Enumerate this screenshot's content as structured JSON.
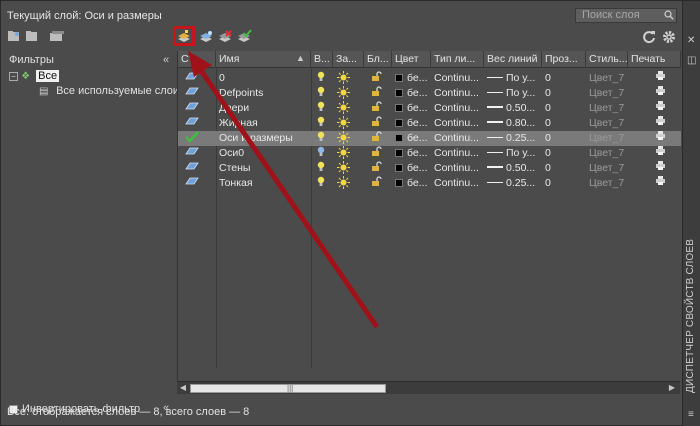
{
  "header": {
    "title": "Текущий слой: Оси и размеры",
    "search_placeholder": "Поиск слоя"
  },
  "filters": {
    "title": "Фильтры",
    "tree": [
      {
        "label": "Все",
        "selected": true
      },
      {
        "label": "Все используемые слои",
        "selected": false
      }
    ],
    "invert_label": "Инвертировать фильтр",
    "invert_checked": false
  },
  "columns": [
    "Ст...",
    "Имя",
    "В...",
    "За...",
    "Бл...",
    "Цвет",
    "Тип ли...",
    "Вес линий",
    "Проз...",
    "Стиль...",
    "Печать"
  ],
  "layers": [
    {
      "name": "0",
      "on_color": "#f2e25a",
      "color": "бе...",
      "linetype": "Continu...",
      "lineweight": "По у...",
      "lw_thick": false,
      "transparency": "0",
      "plot_style": "Цвет_7",
      "current": false
    },
    {
      "name": "Defpoints",
      "on_color": "#f2e25a",
      "color": "бе...",
      "linetype": "Continu...",
      "lineweight": "По у...",
      "lw_thick": false,
      "transparency": "0",
      "plot_style": "Цвет_7",
      "current": false
    },
    {
      "name": "Двери",
      "on_color": "#f2e25a",
      "color": "бе...",
      "linetype": "Continu...",
      "lineweight": "0.50...",
      "lw_thick": true,
      "transparency": "0",
      "plot_style": "Цвет_7",
      "current": false
    },
    {
      "name": "Жирная",
      "on_color": "#f2e25a",
      "color": "бе...",
      "linetype": "Continu...",
      "lineweight": "0.80...",
      "lw_thick": true,
      "transparency": "0",
      "plot_style": "Цвет_7",
      "current": false
    },
    {
      "name": "Оси и размеры",
      "on_color": "#f2e25a",
      "color": "бе...",
      "linetype": "Continu...",
      "lineweight": "0.25...",
      "lw_thick": false,
      "transparency": "0",
      "plot_style": "Цвет_7",
      "current": true
    },
    {
      "name": "Оси0",
      "on_color": "#8fb6e8",
      "color": "бе...",
      "linetype": "Continu...",
      "lineweight": "По у...",
      "lw_thick": false,
      "transparency": "0",
      "plot_style": "Цвет_7",
      "current": false
    },
    {
      "name": "Стены",
      "on_color": "#f2e25a",
      "color": "бе...",
      "linetype": "Continu...",
      "lineweight": "0.50...",
      "lw_thick": true,
      "transparency": "0",
      "plot_style": "Цвет_7",
      "current": false
    },
    {
      "name": "Тонкая",
      "on_color": "#f2e25a",
      "color": "бе...",
      "linetype": "Continu...",
      "lineweight": "0.25...",
      "lw_thick": false,
      "transparency": "0",
      "plot_style": "Цвет_7",
      "current": false
    }
  ],
  "side_label": "ДИСПЕТЧЕР СВОЙСТВ СЛОЕВ",
  "status": "Все: отображается слоев — 8, всего слоев — 8",
  "colors": {
    "accent_red": "#c8151b",
    "current_check": "#3fbf3f"
  }
}
